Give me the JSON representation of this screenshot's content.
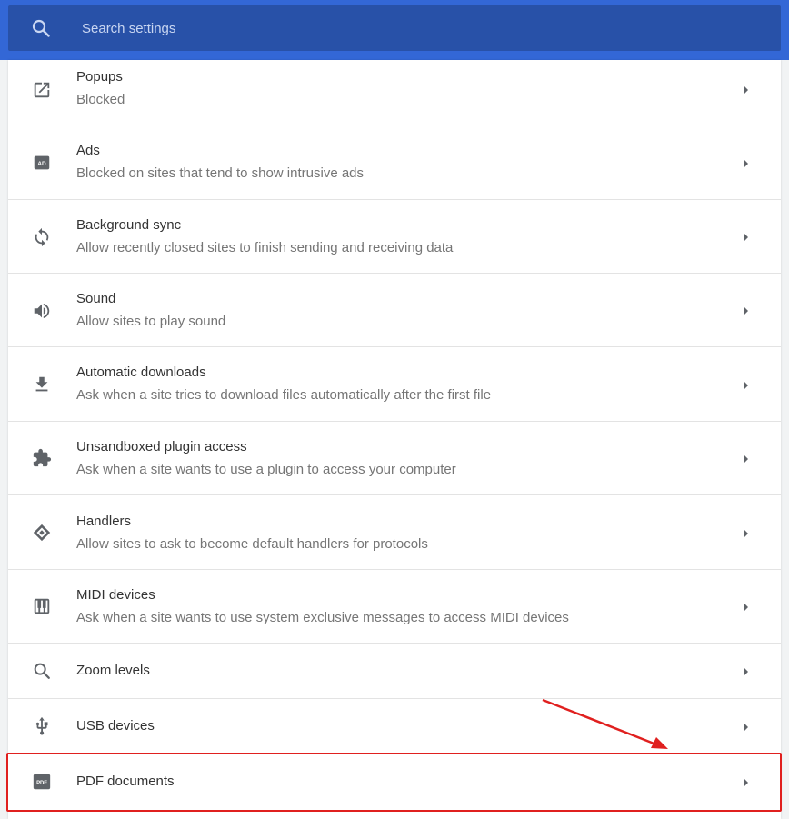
{
  "search": {
    "placeholder": "Search settings",
    "icon": "search-icon"
  },
  "rows": [
    {
      "id": "popups",
      "title": "Popups",
      "subtitle": "Blocked",
      "icon": "open-in-new-icon"
    },
    {
      "id": "ads",
      "title": "Ads",
      "subtitle": "Blocked on sites that tend to show intrusive ads",
      "icon": "ads-icon"
    },
    {
      "id": "background-sync",
      "title": "Background sync",
      "subtitle": "Allow recently closed sites to finish sending and receiving data",
      "icon": "sync-icon"
    },
    {
      "id": "sound",
      "title": "Sound",
      "subtitle": "Allow sites to play sound",
      "icon": "volume-icon"
    },
    {
      "id": "automatic-downloads",
      "title": "Automatic downloads",
      "subtitle": "Ask when a site tries to download files automatically after the first file",
      "icon": "download-icon"
    },
    {
      "id": "unsandboxed-plugin",
      "title": "Unsandboxed plugin access",
      "subtitle": "Ask when a site wants to use a plugin to access your computer",
      "icon": "puzzle-icon"
    },
    {
      "id": "handlers",
      "title": "Handlers",
      "subtitle": "Allow sites to ask to become default handlers for protocols",
      "icon": "handler-icon"
    },
    {
      "id": "midi-devices",
      "title": "MIDI devices",
      "subtitle": "Ask when a site wants to use system exclusive messages to access MIDI devices",
      "icon": "piano-icon"
    },
    {
      "id": "zoom-levels",
      "title": "Zoom levels",
      "subtitle": "",
      "icon": "search-icon"
    },
    {
      "id": "usb-devices",
      "title": "USB devices",
      "subtitle": "",
      "icon": "usb-icon"
    },
    {
      "id": "pdf-documents",
      "title": "PDF documents",
      "subtitle": "",
      "icon": "pdf-icon"
    }
  ],
  "annotation": {
    "highlight_color": "#e0201f",
    "highlighted_row": "pdf-documents"
  },
  "colors": {
    "header": "#3367d6",
    "search_bg": "#2851a8",
    "icon": "#5f6368"
  }
}
